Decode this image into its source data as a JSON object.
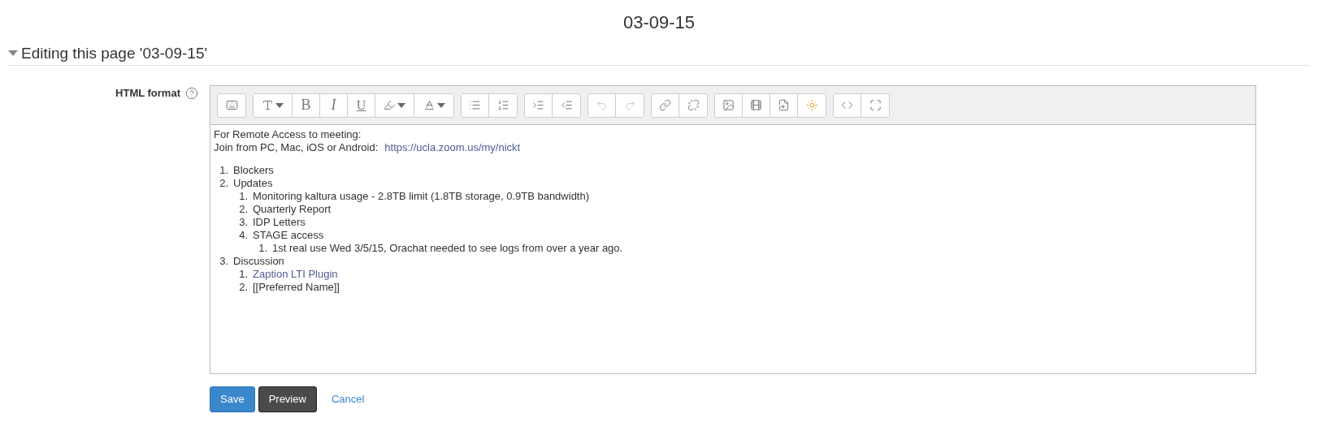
{
  "page_title": "03-09-15",
  "section": {
    "title": "Editing this page '03-09-15'",
    "expanded": true
  },
  "field_label": "HTML format",
  "toolbar": {
    "bold": "B",
    "italic": "I",
    "underline": "U"
  },
  "editor": {
    "lines": [
      {
        "text": "For Remote Access to meeting:"
      },
      {
        "text": "Join from PC, Mac, iOS or Android:",
        "link": "https://ucla.zoom.us/my/nickt"
      }
    ],
    "list": [
      {
        "number": "1.",
        "kind": "text",
        "text": "Blockers"
      },
      {
        "number": "2.",
        "kind": "text",
        "text": "Updates",
        "children": [
          {
            "number": "1.",
            "kind": "text",
            "text": "Monitoring kaltura usage - 2.8TB limit (1.8TB storage, 0.9TB bandwidth)"
          },
          {
            "number": "2.",
            "kind": "text",
            "text": "Quarterly Report"
          },
          {
            "number": "3.",
            "kind": "text",
            "text": "IDP Letters"
          },
          {
            "number": "4.",
            "kind": "text",
            "text": "STAGE access",
            "children": [
              {
                "number": "1.",
                "kind": "text",
                "text": "1st real use Wed 3/5/15, Orachat needed to see logs from over a year ago."
              }
            ]
          }
        ]
      },
      {
        "number": "3.",
        "kind": "text",
        "text": "Discussion",
        "children": [
          {
            "number": "1.",
            "kind": "link",
            "text": "Zaption LTI Plugin"
          },
          {
            "number": "2.",
            "kind": "text",
            "text": "[[Preferred Name]]"
          }
        ]
      }
    ]
  },
  "buttons": [
    {
      "kind": "primary",
      "label": "Save"
    },
    {
      "kind": "dark",
      "label": "Preview"
    },
    {
      "kind": "link",
      "label": "Cancel"
    }
  ]
}
